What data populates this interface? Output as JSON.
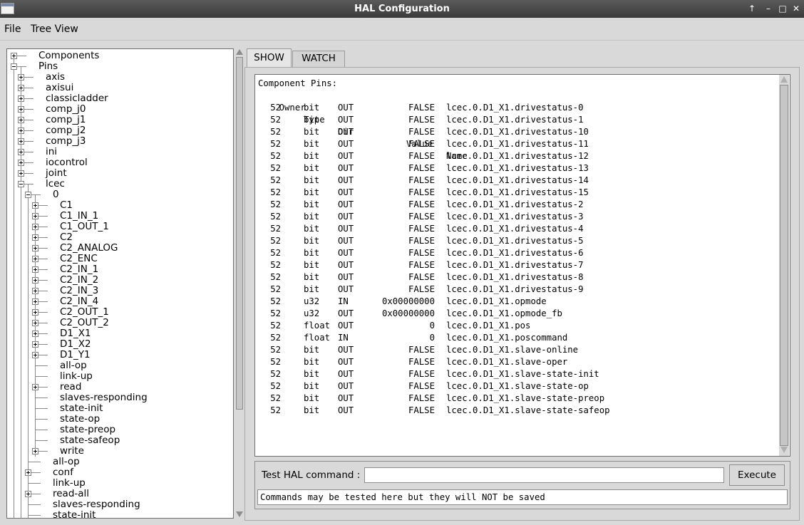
{
  "window": {
    "title": "HAL Configuration"
  },
  "menu": {
    "file": "File",
    "tree_view": "Tree View"
  },
  "tree": {
    "rows": [
      {
        "label": "Components",
        "level": 0,
        "expander": "plus"
      },
      {
        "label": "Pins",
        "level": 0,
        "expander": "minus"
      },
      {
        "label": "axis",
        "level": 1,
        "expander": "plus"
      },
      {
        "label": "axisui",
        "level": 1,
        "expander": "plus"
      },
      {
        "label": "classicladder",
        "level": 1,
        "expander": "plus"
      },
      {
        "label": "comp_j0",
        "level": 1,
        "expander": "plus"
      },
      {
        "label": "comp_j1",
        "level": 1,
        "expander": "plus"
      },
      {
        "label": "comp_j2",
        "level": 1,
        "expander": "plus"
      },
      {
        "label": "comp_j3",
        "level": 1,
        "expander": "plus"
      },
      {
        "label": "ini",
        "level": 1,
        "expander": "plus"
      },
      {
        "label": "iocontrol",
        "level": 1,
        "expander": "plus"
      },
      {
        "label": "joint",
        "level": 1,
        "expander": "plus"
      },
      {
        "label": "lcec",
        "level": 1,
        "expander": "minus"
      },
      {
        "label": "0",
        "level": 2,
        "expander": "minus"
      },
      {
        "label": "C1",
        "level": 3,
        "expander": "plus"
      },
      {
        "label": "C1_IN_1",
        "level": 3,
        "expander": "plus"
      },
      {
        "label": "C1_OUT_1",
        "level": 3,
        "expander": "plus"
      },
      {
        "label": "C2",
        "level": 3,
        "expander": "plus"
      },
      {
        "label": "C2_ANALOG",
        "level": 3,
        "expander": "plus"
      },
      {
        "label": "C2_ENC",
        "level": 3,
        "expander": "plus"
      },
      {
        "label": "C2_IN_1",
        "level": 3,
        "expander": "plus"
      },
      {
        "label": "C2_IN_2",
        "level": 3,
        "expander": "plus"
      },
      {
        "label": "C2_IN_3",
        "level": 3,
        "expander": "plus"
      },
      {
        "label": "C2_IN_4",
        "level": 3,
        "expander": "plus"
      },
      {
        "label": "C2_OUT_1",
        "level": 3,
        "expander": "plus"
      },
      {
        "label": "C2_OUT_2",
        "level": 3,
        "expander": "plus"
      },
      {
        "label": "D1_X1",
        "level": 3,
        "expander": "plus"
      },
      {
        "label": "D1_X2",
        "level": 3,
        "expander": "plus"
      },
      {
        "label": "D1_Y1",
        "level": 3,
        "expander": "plus"
      },
      {
        "label": "all-op",
        "level": 3,
        "expander": "none"
      },
      {
        "label": "link-up",
        "level": 3,
        "expander": "none"
      },
      {
        "label": "read",
        "level": 3,
        "expander": "plus"
      },
      {
        "label": "slaves-responding",
        "level": 3,
        "expander": "none"
      },
      {
        "label": "state-init",
        "level": 3,
        "expander": "none"
      },
      {
        "label": "state-op",
        "level": 3,
        "expander": "none"
      },
      {
        "label": "state-preop",
        "level": 3,
        "expander": "none"
      },
      {
        "label": "state-safeop",
        "level": 3,
        "expander": "none"
      },
      {
        "label": "write",
        "level": 3,
        "expander": "plus"
      },
      {
        "label": "all-op",
        "level": 2,
        "expander": "none"
      },
      {
        "label": "conf",
        "level": 2,
        "expander": "plus"
      },
      {
        "label": "link-up",
        "level": 2,
        "expander": "none"
      },
      {
        "label": "read-all",
        "level": 2,
        "expander": "plus"
      },
      {
        "label": "slaves-responding",
        "level": 2,
        "expander": "none"
      },
      {
        "label": "state-init",
        "level": 2,
        "expander": "none"
      }
    ]
  },
  "tabs": [
    {
      "label": "SHOW",
      "active": true
    },
    {
      "label": "WATCH",
      "active": false
    }
  ],
  "output": {
    "heading": "Component Pins:",
    "columns": {
      "owner": "Owner",
      "type": "Type",
      "dir": "Dir",
      "value": "Value",
      "name": "Name"
    },
    "rows": [
      {
        "owner": "52",
        "type": "bit",
        "dir": "OUT",
        "value": "FALSE",
        "name": "lcec.0.D1_X1.drivestatus-0"
      },
      {
        "owner": "52",
        "type": "bit",
        "dir": "OUT",
        "value": "FALSE",
        "name": "lcec.0.D1_X1.drivestatus-1"
      },
      {
        "owner": "52",
        "type": "bit",
        "dir": "OUT",
        "value": "FALSE",
        "name": "lcec.0.D1_X1.drivestatus-10"
      },
      {
        "owner": "52",
        "type": "bit",
        "dir": "OUT",
        "value": "FALSE",
        "name": "lcec.0.D1_X1.drivestatus-11"
      },
      {
        "owner": "52",
        "type": "bit",
        "dir": "OUT",
        "value": "FALSE",
        "name": "lcec.0.D1_X1.drivestatus-12"
      },
      {
        "owner": "52",
        "type": "bit",
        "dir": "OUT",
        "value": "FALSE",
        "name": "lcec.0.D1_X1.drivestatus-13"
      },
      {
        "owner": "52",
        "type": "bit",
        "dir": "OUT",
        "value": "FALSE",
        "name": "lcec.0.D1_X1.drivestatus-14"
      },
      {
        "owner": "52",
        "type": "bit",
        "dir": "OUT",
        "value": "FALSE",
        "name": "lcec.0.D1_X1.drivestatus-15"
      },
      {
        "owner": "52",
        "type": "bit",
        "dir": "OUT",
        "value": "FALSE",
        "name": "lcec.0.D1_X1.drivestatus-2"
      },
      {
        "owner": "52",
        "type": "bit",
        "dir": "OUT",
        "value": "FALSE",
        "name": "lcec.0.D1_X1.drivestatus-3"
      },
      {
        "owner": "52",
        "type": "bit",
        "dir": "OUT",
        "value": "FALSE",
        "name": "lcec.0.D1_X1.drivestatus-4"
      },
      {
        "owner": "52",
        "type": "bit",
        "dir": "OUT",
        "value": "FALSE",
        "name": "lcec.0.D1_X1.drivestatus-5"
      },
      {
        "owner": "52",
        "type": "bit",
        "dir": "OUT",
        "value": "FALSE",
        "name": "lcec.0.D1_X1.drivestatus-6"
      },
      {
        "owner": "52",
        "type": "bit",
        "dir": "OUT",
        "value": "FALSE",
        "name": "lcec.0.D1_X1.drivestatus-7"
      },
      {
        "owner": "52",
        "type": "bit",
        "dir": "OUT",
        "value": "FALSE",
        "name": "lcec.0.D1_X1.drivestatus-8"
      },
      {
        "owner": "52",
        "type": "bit",
        "dir": "OUT",
        "value": "FALSE",
        "name": "lcec.0.D1_X1.drivestatus-9"
      },
      {
        "owner": "52",
        "type": "u32",
        "dir": "IN",
        "value": "0x00000000",
        "name": "lcec.0.D1_X1.opmode"
      },
      {
        "owner": "52",
        "type": "u32",
        "dir": "OUT",
        "value": "0x00000000",
        "name": "lcec.0.D1_X1.opmode_fb"
      },
      {
        "owner": "52",
        "type": "float",
        "dir": "OUT",
        "value": "0",
        "name": "lcec.0.D1_X1.pos"
      },
      {
        "owner": "52",
        "type": "float",
        "dir": "IN",
        "value": "0",
        "name": "lcec.0.D1_X1.poscommand"
      },
      {
        "owner": "52",
        "type": "bit",
        "dir": "OUT",
        "value": "FALSE",
        "name": "lcec.0.D1_X1.slave-online"
      },
      {
        "owner": "52",
        "type": "bit",
        "dir": "OUT",
        "value": "FALSE",
        "name": "lcec.0.D1_X1.slave-oper"
      },
      {
        "owner": "52",
        "type": "bit",
        "dir": "OUT",
        "value": "FALSE",
        "name": "lcec.0.D1_X1.slave-state-init"
      },
      {
        "owner": "52",
        "type": "bit",
        "dir": "OUT",
        "value": "FALSE",
        "name": "lcec.0.D1_X1.slave-state-op"
      },
      {
        "owner": "52",
        "type": "bit",
        "dir": "OUT",
        "value": "FALSE",
        "name": "lcec.0.D1_X1.slave-state-preop"
      },
      {
        "owner": "52",
        "type": "bit",
        "dir": "OUT",
        "value": "FALSE",
        "name": "lcec.0.D1_X1.slave-state-safeop"
      }
    ]
  },
  "command": {
    "label": "Test HAL command :",
    "input_value": "",
    "execute_label": "Execute",
    "status": "Commands may be tested here but they will NOT be saved"
  }
}
